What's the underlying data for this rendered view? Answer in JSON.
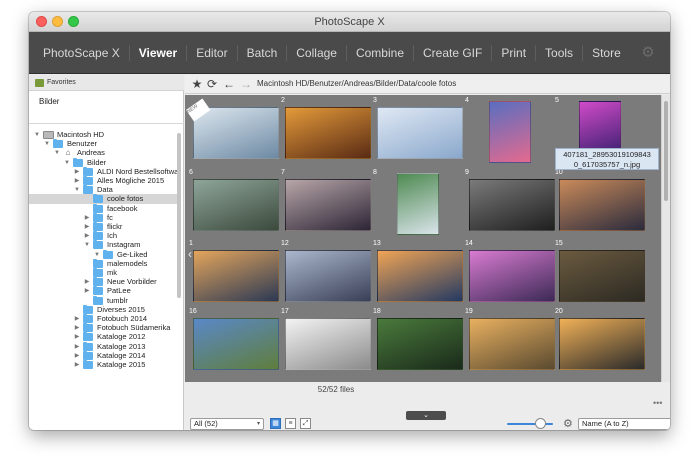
{
  "window": {
    "title": "PhotoScape X"
  },
  "menu": [
    "PhotoScape X",
    "Viewer",
    "Editor",
    "Batch",
    "Collage",
    "Combine",
    "Create GIF",
    "Print",
    "Tools",
    "Store"
  ],
  "menu_active": "Viewer",
  "sidebar": {
    "favorites_header": "Favorites",
    "favorites": [
      "Bilder"
    ],
    "tree": [
      {
        "label": "Macintosh HD",
        "depth": 0,
        "kind": "drive",
        "expanded": true
      },
      {
        "label": "Benutzer",
        "depth": 1,
        "kind": "folder",
        "expanded": true
      },
      {
        "label": "Andreas",
        "depth": 2,
        "kind": "home",
        "expanded": true
      },
      {
        "label": "Bilder",
        "depth": 3,
        "kind": "folder",
        "expanded": true
      },
      {
        "label": "ALDI Nord Bestellsoftware",
        "depth": 4,
        "kind": "folder",
        "expanded": false
      },
      {
        "label": "Alles Mögliche 2015",
        "depth": 4,
        "kind": "folder",
        "expanded": false
      },
      {
        "label": "Data",
        "depth": 4,
        "kind": "folder",
        "expanded": true
      },
      {
        "label": "coole fotos",
        "depth": 5,
        "kind": "folder",
        "expanded": null,
        "selected": true
      },
      {
        "label": "facebook",
        "depth": 5,
        "kind": "folder",
        "expanded": null
      },
      {
        "label": "fc",
        "depth": 5,
        "kind": "folder",
        "expanded": false
      },
      {
        "label": "flickr",
        "depth": 5,
        "kind": "folder",
        "expanded": false
      },
      {
        "label": "Ich",
        "depth": 5,
        "kind": "folder",
        "expanded": false
      },
      {
        "label": "Instagram",
        "depth": 5,
        "kind": "folder",
        "expanded": true
      },
      {
        "label": "Ge-Liked",
        "depth": 6,
        "kind": "folder",
        "expanded": true
      },
      {
        "label": "malemodels",
        "depth": 5,
        "kind": "folder",
        "expanded": null
      },
      {
        "label": "mk",
        "depth": 5,
        "kind": "folder",
        "expanded": null
      },
      {
        "label": "Neue Vorbilder",
        "depth": 5,
        "kind": "folder",
        "expanded": false
      },
      {
        "label": "PatLee",
        "depth": 5,
        "kind": "folder",
        "expanded": false
      },
      {
        "label": "tumblr",
        "depth": 5,
        "kind": "folder",
        "expanded": null
      },
      {
        "label": "Diverses 2015",
        "depth": 4,
        "kind": "folder",
        "expanded": null
      },
      {
        "label": "Fotobuch 2014",
        "depth": 4,
        "kind": "folder",
        "expanded": false
      },
      {
        "label": "Fotobuch Südamerika",
        "depth": 4,
        "kind": "folder",
        "expanded": false
      },
      {
        "label": "Kataloge 2012",
        "depth": 4,
        "kind": "folder",
        "expanded": false
      },
      {
        "label": "Kataloge 2013",
        "depth": 4,
        "kind": "folder",
        "expanded": false
      },
      {
        "label": "Kataloge 2014",
        "depth": 4,
        "kind": "folder",
        "expanded": false
      },
      {
        "label": "Kataloge 2015",
        "depth": 4,
        "kind": "folder",
        "expanded": false
      }
    ]
  },
  "pathbar": {
    "icons": [
      "star-icon",
      "refresh-icon",
      "back-arrow-icon",
      "forward-arrow-icon"
    ],
    "path": "Macintosh HD/Benutzer/Andreas/Bilder/Data/coole fotos"
  },
  "grid": {
    "badge": "NEW",
    "tooltip": "407181_28953019109843\n0_617035757_n.jpg",
    "thumbs": [
      {
        "num": "",
        "c1": "#dce6ee",
        "c2": "#6d8aa4"
      },
      {
        "num": "2",
        "c1": "#e39a3a",
        "c2": "#5a2b14"
      },
      {
        "num": "3",
        "c1": "#dfe8f4",
        "c2": "#8aa8cc"
      },
      {
        "num": "4",
        "c1": "#5a6ec0",
        "c2": "#e46a8f"
      },
      {
        "num": "5",
        "c1": "#d04bc8",
        "c2": "#2a1a66"
      },
      {
        "num": "6",
        "c1": "#8fa59a",
        "c2": "#3b4a3c"
      },
      {
        "num": "7",
        "c1": "#b7a6a8",
        "c2": "#2d2536"
      },
      {
        "num": "8",
        "c1": "#4f8a52",
        "c2": "#d9e4ea"
      },
      {
        "num": "9",
        "c1": "#7a7a7a",
        "c2": "#1f1f1f"
      },
      {
        "num": "10",
        "c1": "#c98a5a",
        "c2": "#2b2b3d"
      },
      {
        "num": "1",
        "c1": "#e3a55c",
        "c2": "#2c3954"
      },
      {
        "num": "12",
        "c1": "#aab7cc",
        "c2": "#3a3f57"
      },
      {
        "num": "13",
        "c1": "#f0a455",
        "c2": "#243a62"
      },
      {
        "num": "14",
        "c1": "#d87bd0",
        "c2": "#3c2a56"
      },
      {
        "num": "15",
        "c1": "#6b5a40",
        "c2": "#2c2a22"
      },
      {
        "num": "16",
        "c1": "#5a88c8",
        "c2": "#5f7e3c"
      },
      {
        "num": "17",
        "c1": "#f3f3f3",
        "c2": "#8b8b8b"
      },
      {
        "num": "18",
        "c1": "#4a7a3c",
        "c2": "#1a2a1a"
      },
      {
        "num": "19",
        "c1": "#e8b060",
        "c2": "#5a4a30"
      },
      {
        "num": "20",
        "c1": "#f0b057",
        "c2": "#2a2a2a"
      }
    ]
  },
  "bottom": {
    "file_count": "52/52 files",
    "filter": "All (52)",
    "sort": "Name (A to Z)",
    "more": "•••",
    "collapse": "⌄"
  }
}
